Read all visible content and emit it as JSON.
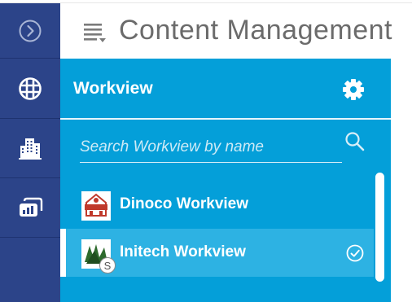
{
  "header": {
    "title": "Content Management",
    "menu_icon": "menu-lines-icon"
  },
  "rail": {
    "items": [
      {
        "name": "collapse",
        "icon": "chevron-right-circle-icon"
      },
      {
        "name": "workview",
        "icon": "globe-grid-icon",
        "active": true
      },
      {
        "name": "buildings",
        "icon": "buildings-icon"
      },
      {
        "name": "dashboard",
        "icon": "bar-chart-icon"
      }
    ]
  },
  "panel": {
    "title": "Workview",
    "settings_icon": "gear-icon",
    "search": {
      "placeholder": "Search Workview by name",
      "value": "",
      "icon": "search-icon"
    },
    "items": [
      {
        "label": "Dinoco Workview",
        "selected": false,
        "badge": ""
      },
      {
        "label": "Initech Workview",
        "selected": true,
        "badge": "S",
        "status_icon": "check-circle-icon"
      }
    ]
  },
  "colors": {
    "rail": "#2c4489",
    "panel": "#049fd9",
    "selected_row": "#2db2e3",
    "title_text": "#6b6b6b"
  }
}
